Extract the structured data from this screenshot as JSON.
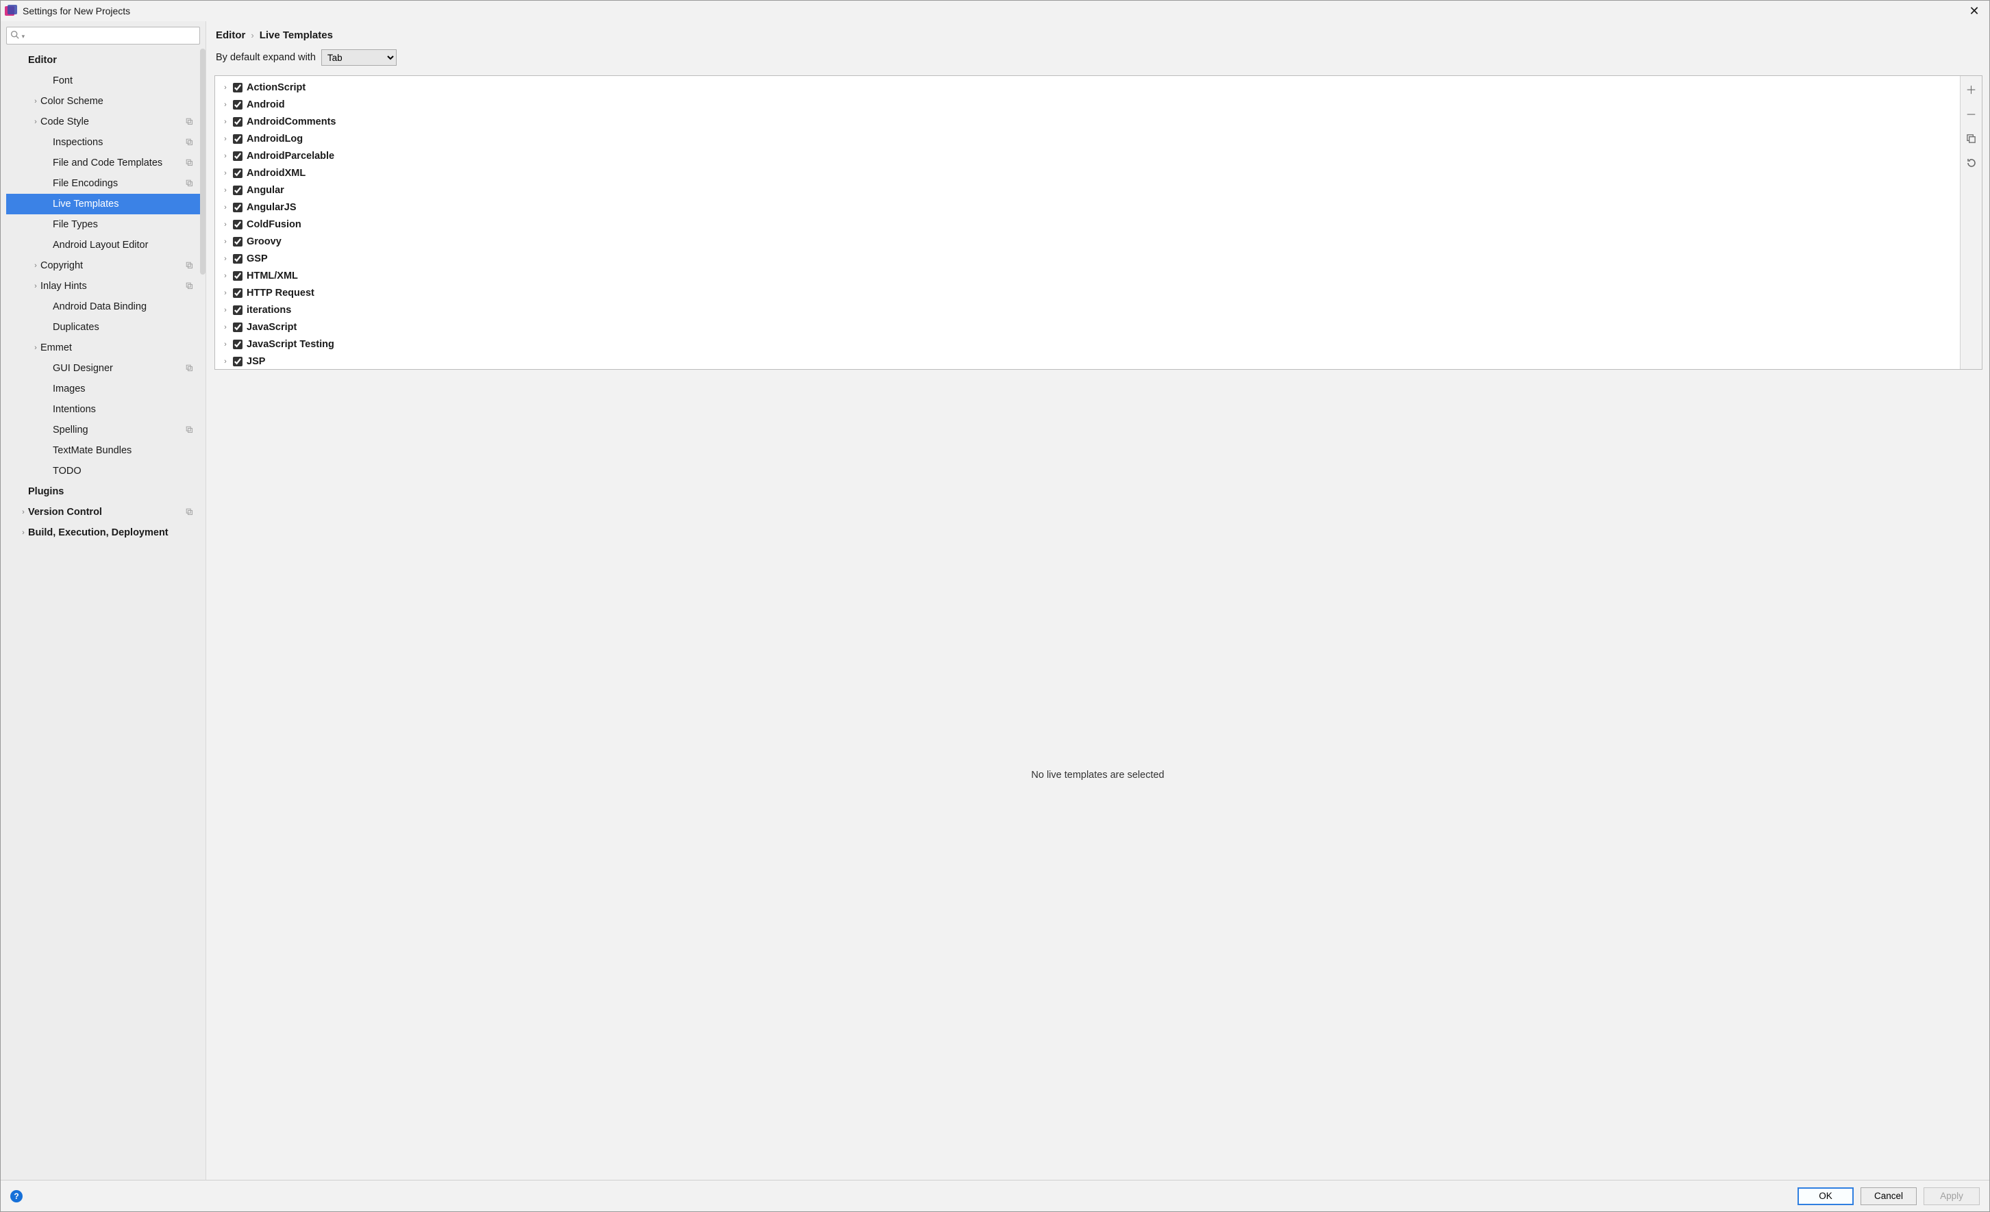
{
  "titlebar": {
    "title": "Settings for New Projects"
  },
  "sidebar": {
    "search_placeholder": "",
    "items": [
      {
        "label": "Editor",
        "indent": 0,
        "bold": true,
        "expander": "",
        "copy": false,
        "selected": false
      },
      {
        "label": "Font",
        "indent": 2,
        "bold": false,
        "expander": "",
        "copy": false,
        "selected": false
      },
      {
        "label": "Color Scheme",
        "indent": 1,
        "bold": false,
        "expander": "›",
        "copy": false,
        "selected": false
      },
      {
        "label": "Code Style",
        "indent": 1,
        "bold": false,
        "expander": "›",
        "copy": true,
        "selected": false
      },
      {
        "label": "Inspections",
        "indent": 2,
        "bold": false,
        "expander": "",
        "copy": true,
        "selected": false
      },
      {
        "label": "File and Code Templates",
        "indent": 2,
        "bold": false,
        "expander": "",
        "copy": true,
        "selected": false
      },
      {
        "label": "File Encodings",
        "indent": 2,
        "bold": false,
        "expander": "",
        "copy": true,
        "selected": false
      },
      {
        "label": "Live Templates",
        "indent": 2,
        "bold": false,
        "expander": "",
        "copy": false,
        "selected": true
      },
      {
        "label": "File Types",
        "indent": 2,
        "bold": false,
        "expander": "",
        "copy": false,
        "selected": false
      },
      {
        "label": "Android Layout Editor",
        "indent": 2,
        "bold": false,
        "expander": "",
        "copy": false,
        "selected": false
      },
      {
        "label": "Copyright",
        "indent": 1,
        "bold": false,
        "expander": "›",
        "copy": true,
        "selected": false
      },
      {
        "label": "Inlay Hints",
        "indent": 1,
        "bold": false,
        "expander": "›",
        "copy": true,
        "selected": false
      },
      {
        "label": "Android Data Binding",
        "indent": 2,
        "bold": false,
        "expander": "",
        "copy": false,
        "selected": false
      },
      {
        "label": "Duplicates",
        "indent": 2,
        "bold": false,
        "expander": "",
        "copy": false,
        "selected": false
      },
      {
        "label": "Emmet",
        "indent": 1,
        "bold": false,
        "expander": "›",
        "copy": false,
        "selected": false
      },
      {
        "label": "GUI Designer",
        "indent": 2,
        "bold": false,
        "expander": "",
        "copy": true,
        "selected": false
      },
      {
        "label": "Images",
        "indent": 2,
        "bold": false,
        "expander": "",
        "copy": false,
        "selected": false
      },
      {
        "label": "Intentions",
        "indent": 2,
        "bold": false,
        "expander": "",
        "copy": false,
        "selected": false
      },
      {
        "label": "Spelling",
        "indent": 2,
        "bold": false,
        "expander": "",
        "copy": true,
        "selected": false
      },
      {
        "label": "TextMate Bundles",
        "indent": 2,
        "bold": false,
        "expander": "",
        "copy": false,
        "selected": false
      },
      {
        "label": "TODO",
        "indent": 2,
        "bold": false,
        "expander": "",
        "copy": false,
        "selected": false
      },
      {
        "label": "Plugins",
        "indent": 0,
        "bold": true,
        "expander": "",
        "copy": false,
        "selected": false
      },
      {
        "label": "Version Control",
        "indent": 0,
        "bold": true,
        "expander": "›",
        "copy": true,
        "selected": false
      },
      {
        "label": "Build, Execution, Deployment",
        "indent": 0,
        "bold": true,
        "expander": "›",
        "copy": false,
        "selected": false
      }
    ]
  },
  "breadcrumb": {
    "root": "Editor",
    "leaf": "Live Templates"
  },
  "default_expand": {
    "label": "By default expand with",
    "selected": "Tab"
  },
  "template_groups": [
    {
      "name": "ActionScript",
      "checked": true
    },
    {
      "name": "Android",
      "checked": true
    },
    {
      "name": "AndroidComments",
      "checked": true
    },
    {
      "name": "AndroidLog",
      "checked": true
    },
    {
      "name": "AndroidParcelable",
      "checked": true
    },
    {
      "name": "AndroidXML",
      "checked": true
    },
    {
      "name": "Angular",
      "checked": true
    },
    {
      "name": "AngularJS",
      "checked": true
    },
    {
      "name": "ColdFusion",
      "checked": true
    },
    {
      "name": "Groovy",
      "checked": true
    },
    {
      "name": "GSP",
      "checked": true
    },
    {
      "name": "HTML/XML",
      "checked": true
    },
    {
      "name": "HTTP Request",
      "checked": true
    },
    {
      "name": "iterations",
      "checked": true
    },
    {
      "name": "JavaScript",
      "checked": true
    },
    {
      "name": "JavaScript Testing",
      "checked": true
    },
    {
      "name": "JSP",
      "checked": true
    }
  ],
  "placeholder_text": "No live templates are selected",
  "footer": {
    "ok": "OK",
    "cancel": "Cancel",
    "apply": "Apply"
  }
}
